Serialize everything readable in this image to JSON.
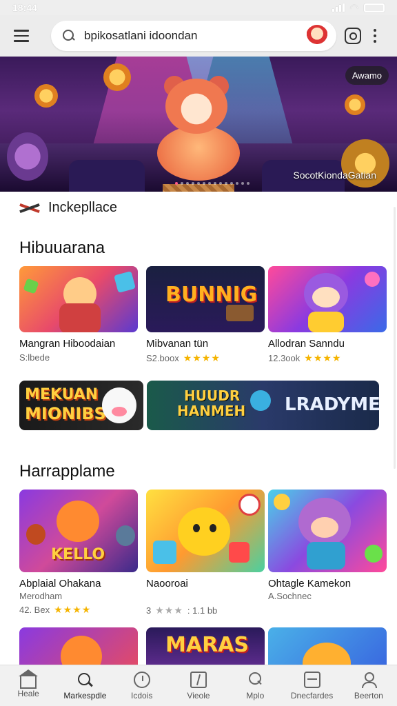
{
  "status_bar": {
    "time": "18:44"
  },
  "search": {
    "query": "bpikosatlani idoondan"
  },
  "banner": {
    "badge": "Awamo",
    "caption": "SocotKiondaGatian"
  },
  "marketplace": {
    "label": "Inckepllace"
  },
  "sections": [
    {
      "title": "Hibuuarana",
      "cards": [
        {
          "title": "Mangran Hiboodaian",
          "meta": "S:lbede",
          "stars": ""
        },
        {
          "title": "Mibvanan tün",
          "meta": "S2.boox",
          "stars": "★★★★"
        },
        {
          "title": "Allodran Sanndu",
          "meta": "12.3ook",
          "stars": "★★★★"
        }
      ],
      "banners": [
        {
          "line1": "MEKUAN",
          "line2": "MIONIBS"
        },
        {
          "line1": "HUUDR",
          "line2": "HANMEH",
          "line3": "LRADYME"
        }
      ]
    },
    {
      "title": "Harrapplame",
      "cards": [
        {
          "title": "Abplaial Ohakana",
          "sub": "Merodham",
          "meta": "42. Bex",
          "stars": "★★★★",
          "stars_after": ""
        },
        {
          "title": "Naooroai",
          "sub": "",
          "meta": "3",
          "stars": "★★",
          "stars_off": "★",
          "meta_after": ": 1.1 bb"
        },
        {
          "title": "Ohtagle Kamekon",
          "sub": "A.Sochnec",
          "meta": "",
          "stars": ""
        }
      ]
    }
  ],
  "thumb_texts": {
    "bunnig": "BUNNIG",
    "kello": "KELLO",
    "maras": "MARAS"
  },
  "nav": [
    {
      "label": "Heale",
      "icon": "home-icon"
    },
    {
      "label": "Markespdle",
      "icon": "search-icon"
    },
    {
      "label": "Icdois",
      "icon": "clock-icon"
    },
    {
      "label": "Vieole",
      "icon": "book-icon"
    },
    {
      "label": "Mplo",
      "icon": "pin-icon"
    },
    {
      "label": "Dnecfardes",
      "icon": "inbox-icon"
    },
    {
      "label": "Beerton",
      "icon": "person-icon"
    }
  ],
  "colors": {
    "accent": "#f5b400",
    "nav_bg": "#f1f1f1",
    "topbar_bg": "#ececec"
  }
}
